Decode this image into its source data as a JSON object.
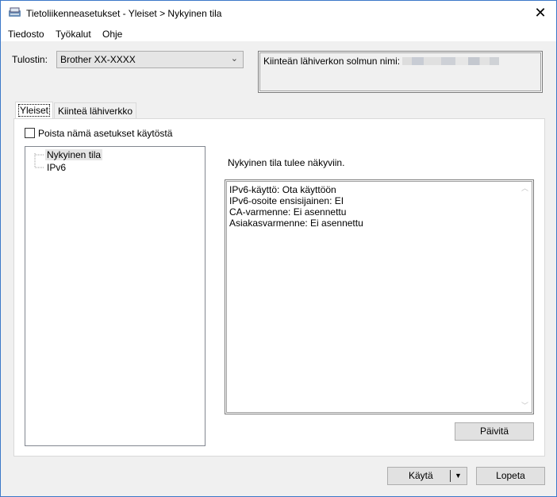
{
  "window": {
    "title": "Tietoliikenneasetukset - Yleiset > Nykyinen tila",
    "close_icon": "close-icon",
    "border_color": "#3c78c8"
  },
  "menu": [
    {
      "label": "Tiedosto"
    },
    {
      "label": "Työkalut"
    },
    {
      "label": "Ohje"
    }
  ],
  "printer": {
    "label": "Tulostin:",
    "value": "Brother  XX-XXXX"
  },
  "node": {
    "label": "Kiinteän lähiverkon solmun nimi:"
  },
  "tabs": [
    {
      "label": "Yleiset",
      "active": true
    },
    {
      "label": "Kiinteä lähiverkko",
      "active": false
    }
  ],
  "disable_checkbox": {
    "label": "Poista nämä asetukset käytöstä",
    "checked": false
  },
  "tree": [
    {
      "label": "Nykyinen tila",
      "selected": true
    },
    {
      "label": "IPv6",
      "selected": false
    }
  ],
  "status": {
    "heading": "Nykyinen tila tulee näkyviin.",
    "lines": [
      "IPv6-käyttö: Ota käyttöön",
      "IPv6-osoite ensisijainen: EI",
      "CA-varmenne: Ei asennettu",
      "Asiakasvarmenne: Ei asennettu"
    ]
  },
  "buttons": {
    "refresh": "Päivitä",
    "apply": "Käytä",
    "quit": "Lopeta"
  }
}
